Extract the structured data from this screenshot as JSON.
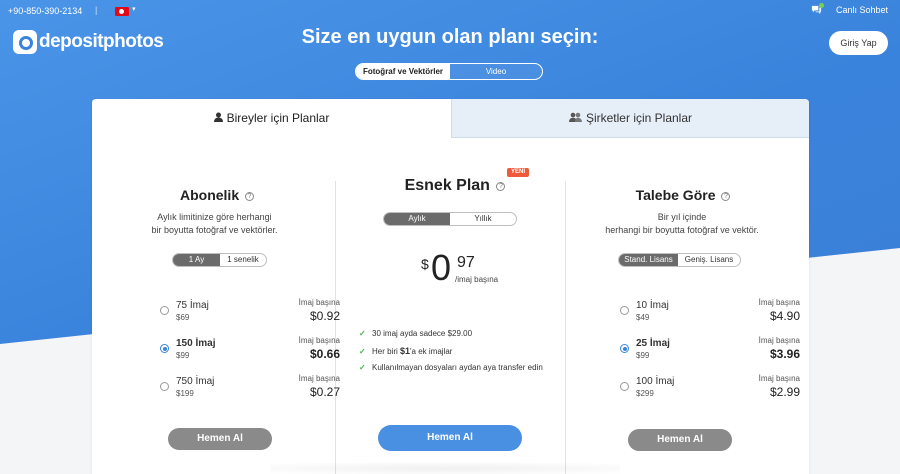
{
  "topbar": {
    "phone": "+90-850-390-2134",
    "separator": "|",
    "language_caret": "▾",
    "chat_label": "Canlı Sohbet"
  },
  "brand": {
    "logo_text": "depositphotos",
    "accent_color": "#3a83dc"
  },
  "header": {
    "login_label": "Giriş Yap",
    "headline": "Size en uygun olan planı seçin:",
    "media_toggle": {
      "options": [
        "Fotoğraf ve Vektörler",
        "Video"
      ],
      "selected": "Fotoğraf ve Vektörler"
    }
  },
  "tabs": [
    {
      "label": "Bireyler için Planlar",
      "active": true,
      "icon": "person-icon"
    },
    {
      "label": "Şirketler için Planlar",
      "active": false,
      "icon": "people-icon"
    }
  ],
  "help_glyph": "?",
  "plans": {
    "subscription": {
      "title": "Abonelik",
      "description_1": "Aylık limitinize göre herhangi",
      "description_2": "bir boyutta fotoğraf ve vektörler.",
      "toggle": [
        "1 Ay",
        "1 senelik"
      ],
      "toggle_selected": "1 Ay",
      "options": [
        {
          "qty": "75 İmaj",
          "total": "$69",
          "per_label": "İmaj başına",
          "price": "$0.92",
          "selected": false
        },
        {
          "qty": "150 İmaj",
          "total": "$99",
          "per_label": "İmaj başına",
          "price": "$0.66",
          "selected": true
        },
        {
          "qty": "750 İmaj",
          "total": "$199",
          "per_label": "İmaj başına",
          "price": "$0.27",
          "selected": false
        }
      ],
      "cta": "Hemen Al"
    },
    "flexible": {
      "title": "Esnek Plan",
      "badge": "YENİ",
      "toggle": [
        "Aylık",
        "Yıllık"
      ],
      "toggle_selected": "Aylık",
      "price_dollar": "$",
      "price_int": "0",
      "price_cents": "97",
      "price_unit": "/imaj başına",
      "features": [
        {
          "text": "30 imaj ayda sadece $29.00"
        },
        {
          "pre": "Her biri ",
          "bold": "$1",
          "post": "'a ek imajlar"
        },
        {
          "text": "Kullanılmayan dosyaları aydan aya transfer edin"
        }
      ],
      "check_glyph": "✓",
      "cta": "Hemen Al"
    },
    "on_demand": {
      "title": "Talebe Göre",
      "description_1": "Bir yıl içinde",
      "description_2": "herhangi bir boyutta fotoğraf ve vektör.",
      "toggle": [
        "Stand. Lisans",
        "Geniş. Lisans"
      ],
      "toggle_selected": "Stand. Lisans",
      "options": [
        {
          "qty": "10 İmaj",
          "total": "$49",
          "per_label": "İmaj başına",
          "price": "$4.90",
          "selected": false
        },
        {
          "qty": "25 İmaj",
          "total": "$99",
          "per_label": "İmaj başına",
          "price": "$3.96",
          "selected": true
        },
        {
          "qty": "100 İmaj",
          "total": "$299",
          "per_label": "İmaj başına",
          "price": "$2.99",
          "selected": false
        }
      ],
      "cta": "Hemen Al"
    }
  }
}
